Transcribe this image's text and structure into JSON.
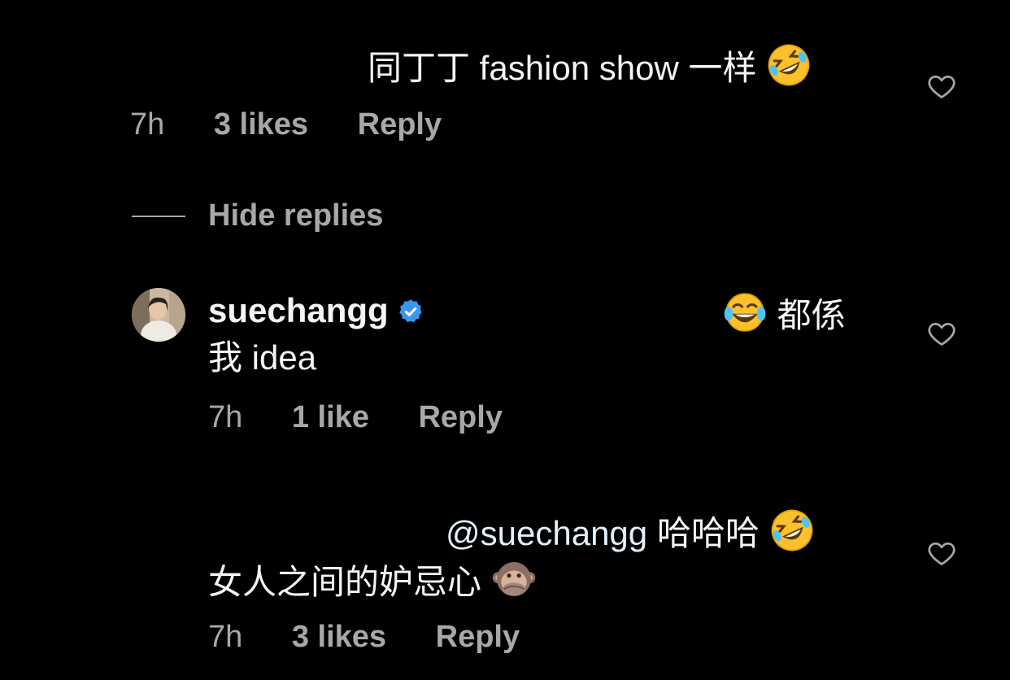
{
  "comment1": {
    "text": "同丁丁 fashion show 一样",
    "emoji": "rolling-on-floor-laughing",
    "time": "7h",
    "likes": "3 likes",
    "reply_label": "Reply"
  },
  "replies_toggle": {
    "label": "Hide replies"
  },
  "reply1": {
    "username": "suechangg",
    "verified": true,
    "line1_emoji": "face-with-tears-of-joy",
    "line1_text": "都係",
    "line2_text": "我 idea",
    "time": "7h",
    "likes": "1 like",
    "reply_label": "Reply"
  },
  "reply2": {
    "mention": "@suechangg",
    "line1_text": "哈哈哈",
    "line1_emoji": "rolling-on-floor-laughing",
    "line2_text": "女人之间的妒忌心",
    "line2_emoji": "speak-no-evil-monkey",
    "time": "7h",
    "likes": "3 likes",
    "reply_label": "Reply"
  },
  "colors": {
    "background": "#000000",
    "primary_text": "#f5f5f5",
    "secondary_text": "#a8a8a8",
    "verified_badge": "#3897f0",
    "mention": "#e0f1ff"
  }
}
